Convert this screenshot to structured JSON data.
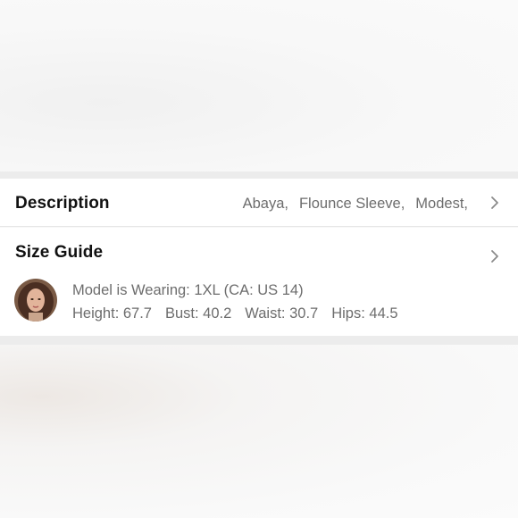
{
  "description": {
    "title": "Description",
    "tags": [
      "Abaya,",
      "Flounce Sleeve,",
      "Modest,"
    ]
  },
  "size_guide": {
    "title": "Size Guide",
    "model_wearing": "Model is Wearing: 1XL (CA: US 14)",
    "measurements": [
      "Height: 67.7",
      "Bust: 40.2",
      "Waist: 30.7",
      "Hips: 44.5"
    ]
  },
  "icons": {
    "description_chevron": "chevron-right-icon",
    "size_guide_chevron": "chevron-right-icon",
    "avatar": "model-avatar"
  },
  "colors": {
    "title_text": "#111111",
    "secondary_text": "#6d6d6d",
    "card_background": "#ffffff",
    "separator": "#ececec"
  }
}
